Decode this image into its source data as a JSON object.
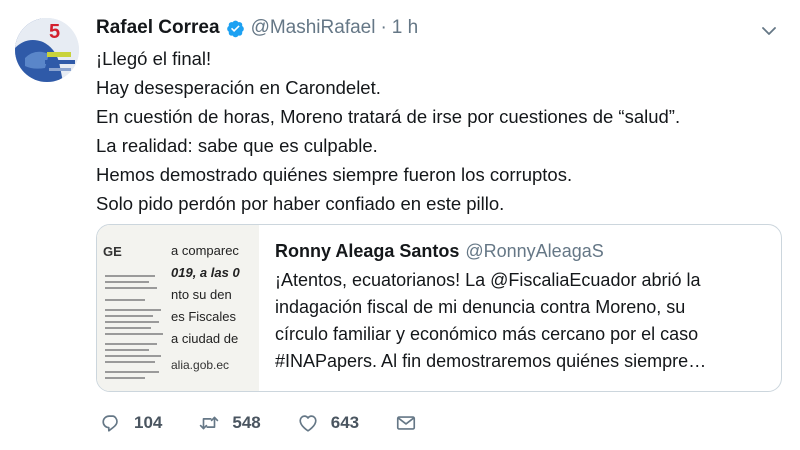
{
  "tweet": {
    "author_name": "Rafael Correa",
    "handle": "@MashiRafael",
    "separator": "·",
    "time": "1 h",
    "lines": [
      "¡Llegó el final!",
      "Hay desesperación en Carondelet.",
      "En cuestión de horas, Moreno tratará de irse por cuestiones de “salud”.",
      "La realidad: sabe que es culpable.",
      "Hemos demostrado quiénes siempre fueron los corruptos.",
      "Solo pido perdón por haber confiado en este pillo."
    ]
  },
  "quoted": {
    "author_name": "Ronny Aleaga Santos",
    "handle": "@RonnyAleagaS",
    "lines": [
      "¡Atentos, ecuatorianos! La @FiscaliaEcuador abrió la",
      "indagación fiscal de mi denuncia contra Moreno, su",
      "círculo familiar y económico más cercano por el caso",
      "#INAPapers. Al fin demostraremos quiénes siempre…"
    ],
    "image_text": {
      "logo": "GE",
      "line1": "a comparec",
      "line2": "019, a las 0",
      "line3": "nto su den",
      "line4": "es Fiscales",
      "line5": "a ciudad de",
      "url": "alia.gob.ec"
    }
  },
  "actions": {
    "replies": "104",
    "retweets": "548",
    "likes": "643"
  },
  "colors": {
    "text": "#14171a",
    "muted": "#657786",
    "verified": "#1da1f2",
    "border": "#ccd6dd"
  }
}
